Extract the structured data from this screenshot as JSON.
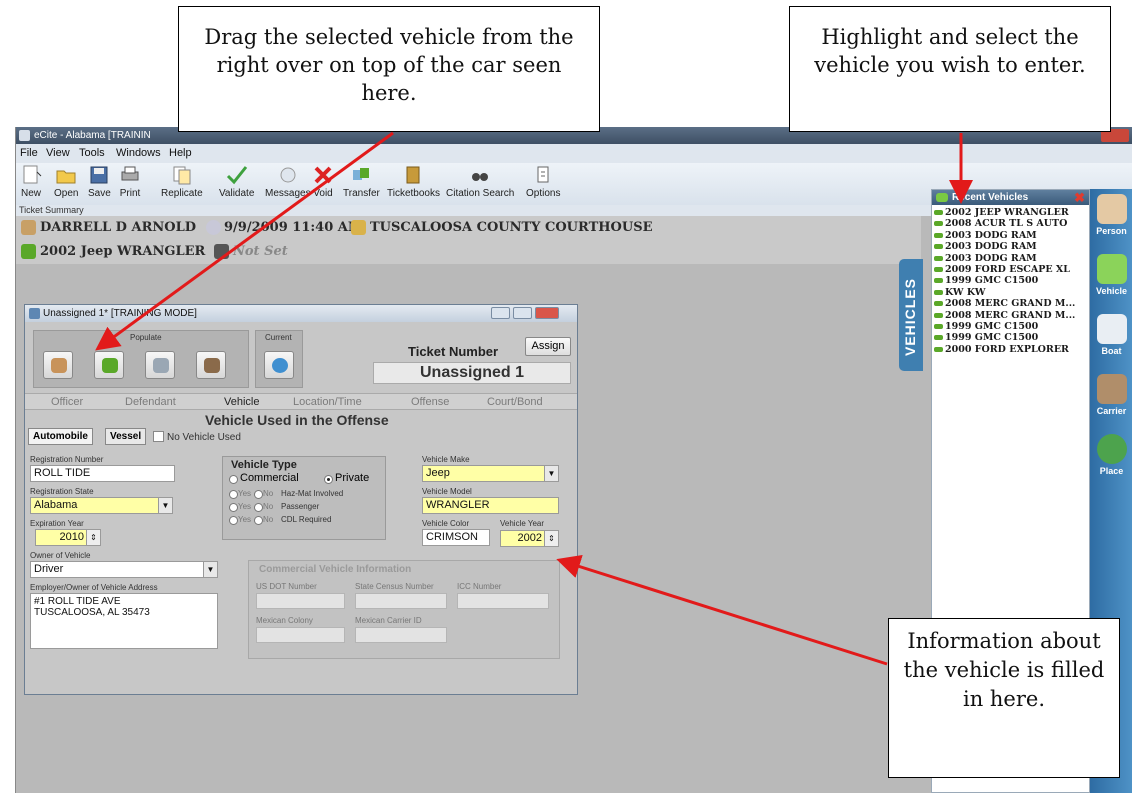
{
  "callouts": {
    "drag": "Drag the selected vehicle from the right over on top of the car seen here.",
    "highlight": "Highlight and select the vehicle you wish to enter.",
    "info": "Information about the vehicle is filled in here."
  },
  "window": {
    "title": "eCite - Alabama [TRAININ"
  },
  "menu": [
    "File",
    "View",
    "Tools",
    "Windows",
    "Help"
  ],
  "toolbar": {
    "new": "New",
    "open": "Open",
    "save": "Save",
    "print": "Print",
    "replicate": "Replicate",
    "validate": "Validate",
    "messages": "Messages",
    "void": "Void",
    "transfer": "Transfer",
    "ticketbooks": "Ticketbooks",
    "citation_search": "Citation Search",
    "options": "Options"
  },
  "ticket_summary": {
    "label": "Ticket Summary",
    "officer": "DARRELL D ARNOLD",
    "datetime": "9/9/2009 11:40 AM",
    "location": "TUSCALOOSA COUNTY COURTHOUSE",
    "vehicle": "2002 Jeep WRANGLER",
    "not_set": "Not Set"
  },
  "vehicles_tab": "VEHICLES",
  "recent": {
    "title": "Recent Vehicles",
    "items": [
      "2002 JEEP WRANGLER",
      "2008 ACUR TL S AUTO",
      "2003 DODG RAM",
      "2003 DODG RAM",
      "2003 DODG RAM",
      "2009 FORD ESCAPE XL",
      "1999 GMC C1500",
      "KW KW",
      "2008 MERC GRAND M...",
      "2008 MERC GRAND M...",
      "1999 GMC C1500",
      "1999 GMC C1500",
      "2000 FORD EXPLORER"
    ]
  },
  "sidebar": [
    "Person",
    "Vehicle",
    "Boat",
    "Carrier",
    "Place"
  ],
  "dialog": {
    "title": "Unassigned 1* [TRAINING MODE]",
    "populate": "Populate",
    "current": "Current",
    "ticket_number_label": "Ticket Number",
    "assign": "Assign",
    "ticket_number": "Unassigned 1",
    "tabs": [
      "Officer",
      "Defendant",
      "Vehicle",
      "Location/Time",
      "Offense",
      "Court/Bond"
    ],
    "section_title": "Vehicle Used in the Offense",
    "automobile": "Automobile",
    "vessel": "Vessel",
    "no_vehicle": "No Vehicle Used",
    "registration_number_label": "Registration Number",
    "registration_number": "ROLL TIDE",
    "registration_state_label": "Registration State",
    "registration_state": "Alabama",
    "expiration_year_label": "Expiration Year",
    "expiration_year": "2010",
    "owner_label": "Owner of Vehicle",
    "owner": "Driver",
    "employer_label": "Employer/Owner of Vehicle Address",
    "address_line1": "#1 ROLL TIDE AVE",
    "address_line2": "TUSCALOOSA, AL 35473",
    "vehicle_type_label": "Vehicle Type",
    "commercial": "Commercial",
    "private": "Private",
    "yes": "Yes",
    "no": "No",
    "hazmat": "Haz-Mat Involved",
    "passenger": "Passenger",
    "cdl": "CDL Required",
    "make_label": "Vehicle Make",
    "make": "Jeep",
    "model_label": "Vehicle Model",
    "model": "WRANGLER",
    "color_label": "Vehicle Color",
    "color": "CRIMSON",
    "year_label": "Vehicle Year",
    "year": "2002",
    "commercial_info": "Commercial Vehicle Information",
    "us_dot": "US DOT Number",
    "state_census": "State Census Number",
    "icc": "ICC Number",
    "mexican_colony": "Mexican Colony",
    "mexican_carrier": "Mexican Carrier ID"
  }
}
